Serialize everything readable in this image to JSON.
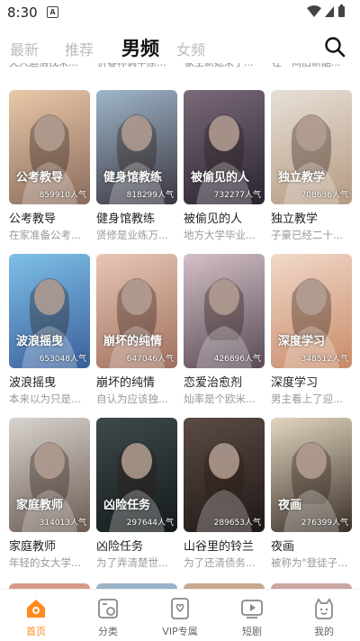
{
  "status": {
    "time": "8:30",
    "notif_glyph": "A"
  },
  "tabs": [
    {
      "label": "最新"
    },
    {
      "label": "推荐"
    },
    {
      "label": "男频"
    },
    {
      "label": "女频"
    }
  ],
  "active_tab": "男频",
  "top_cut_texts": [
    "夫人运情找来...",
    "价春称调中原...",
    "家主新媳来了...",
    "在一间旧新酷..."
  ],
  "cards": [
    {
      "title": "公考教导",
      "desc": "在家准备公考...",
      "popularity": "859910人气",
      "cover_words": "公考教导",
      "bg1": "#e9c9a9",
      "bg2": "#8a6b5c"
    },
    {
      "title": "健身馆教练",
      "desc": "贤修是业练万...",
      "popularity": "818299人气",
      "cover_words": "健身馆教练",
      "bg1": "#9fb7c9",
      "bg2": "#3a3540"
    },
    {
      "title": "被偷见的人",
      "desc": "地方大学毕业...",
      "popularity": "732277人气",
      "cover_words": "被偷见的人",
      "bg1": "#7a6a7a",
      "bg2": "#2a2330"
    },
    {
      "title": "独立教学",
      "desc": "子豪已经二十...",
      "popularity": "708636人气",
      "cover_words": "独立教学",
      "bg1": "#e7e0d6",
      "bg2": "#b59a82"
    },
    {
      "title": "波浪摇曳",
      "desc": "本来以为只是...",
      "popularity": "653048人气",
      "cover_words": "波浪摇曳",
      "bg1": "#7ec0e8",
      "bg2": "#3b5f9a"
    },
    {
      "title": "崩坏的纯情",
      "desc": "自认为应该独...",
      "popularity": "647046人气",
      "cover_words": "崩坏的纯情",
      "bg1": "#e8c7b4",
      "bg2": "#a07060"
    },
    {
      "title": "恋爱治愈剂",
      "desc": "灿率是个欧米...",
      "popularity": "426896人气",
      "cover_words": "",
      "bg1": "#d3c0c8",
      "bg2": "#5a4a55"
    },
    {
      "title": "深度学习",
      "desc": "男主看上了迎...",
      "popularity": "348512人气",
      "cover_words": "深度学习",
      "bg1": "#f1d9c9",
      "bg2": "#c98b6a"
    },
    {
      "title": "家庭教师",
      "desc": "年轻的女大学...",
      "popularity": "314013人气",
      "cover_words": "家庭教师",
      "bg1": "#d9d4cf",
      "bg2": "#6b5b52"
    },
    {
      "title": "凶险任务",
      "desc": "为了弄清楚世...",
      "popularity": "297644人气",
      "cover_words": "凶险任务",
      "bg1": "#3e4a4a",
      "bg2": "#151a1c"
    },
    {
      "title": "山谷里的铃兰",
      "desc": "为了还清债务...",
      "popularity": "289653人气",
      "cover_words": "",
      "bg1": "#5b4b45",
      "bg2": "#201816"
    },
    {
      "title": "夜画",
      "desc": "被称为\"登徒子...",
      "popularity": "276399人气",
      "cover_words": "夜画",
      "bg1": "#e3d6c0",
      "bg2": "#3a3028"
    }
  ],
  "bottom_nav": [
    {
      "label": "首页",
      "icon": "home-icon"
    },
    {
      "label": "分类",
      "icon": "category-icon"
    },
    {
      "label": "VIP专属",
      "icon": "vip-book-icon"
    },
    {
      "label": "短剧",
      "icon": "short-drama-icon"
    },
    {
      "label": "我的",
      "icon": "profile-icon"
    }
  ],
  "colors": {
    "accent": "#ff8a1f",
    "text": "#222222",
    "muted": "#999999"
  }
}
